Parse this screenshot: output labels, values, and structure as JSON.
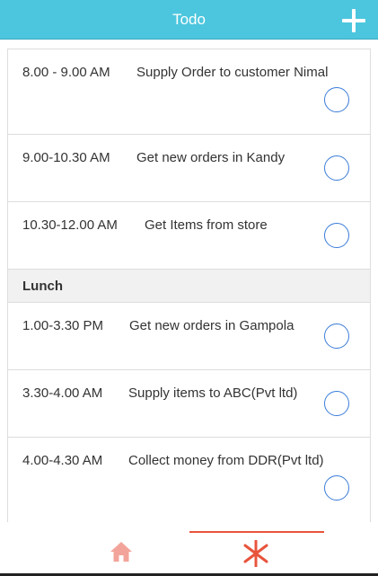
{
  "header": {
    "title": "Todo",
    "add_icon": "plus-icon"
  },
  "tasks_morning": [
    {
      "time": "8.00 - 9.00 AM",
      "title": "Supply Order to customer Nimal"
    },
    {
      "time": "9.00-10.30 AM",
      "title": "Get new orders in Kandy"
    },
    {
      "time": "10.30-12.00 AM",
      "title": "Get Items from store"
    }
  ],
  "divider": {
    "label": "Lunch"
  },
  "tasks_afternoon": [
    {
      "time": "1.00-3.30 PM",
      "title": "Get new orders in Gampola"
    },
    {
      "time": "3.30-4.00 AM",
      "title": "Supply items to ABC(Pvt ltd)"
    },
    {
      "time": "4.00-4.30 AM",
      "title": "Collect money from DDR(Pvt ltd)"
    }
  ],
  "tabbar": {
    "tabs": [
      {
        "name": "home",
        "icon": "home-icon",
        "active": false
      },
      {
        "name": "todo",
        "icon": "asterisk-icon",
        "active": true
      }
    ],
    "icon_color": "#f3a49a",
    "active_color": "#e8543c"
  },
  "colors": {
    "header": "#4cc6de",
    "checkbox": "#3b7dd8",
    "divider_bg": "#f1f1f1"
  }
}
